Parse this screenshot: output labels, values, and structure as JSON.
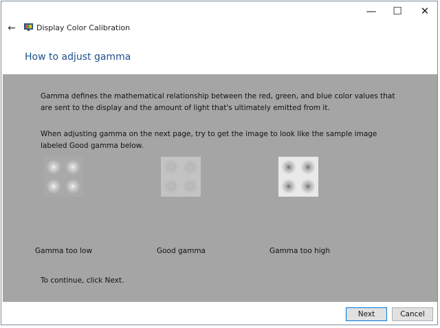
{
  "window": {
    "title": "Display Color Calibration",
    "controls": {
      "minimize": "—",
      "maximize": "☐",
      "close": "✕"
    },
    "back_icon": "←"
  },
  "header": {
    "page_title": "How to adjust gamma"
  },
  "main": {
    "paragraph1": "Gamma defines the mathematical relationship between the red, green, and blue color values that are sent to the display and the amount of light that's ultimately emitted from it.",
    "paragraph2": "When adjusting gamma on the next page, try to get the image to look like the sample image labeled Good gamma below.",
    "samples": [
      {
        "label": "Gamma too low",
        "tile": "#a9a9a9",
        "dot_center": "#e8e8e8",
        "dot_ring": "#9e9e9e"
      },
      {
        "label": "Good gamma",
        "tile": "#c3c3c3",
        "dot_center": "#b6b6b6",
        "dot_ring": "#b3b3b3"
      },
      {
        "label": "Gamma too high",
        "tile": "#e9e9e9",
        "dot_center": "#7a7a7a",
        "dot_ring": "#d0d0d0"
      }
    ],
    "continue_text": "To continue, click Next."
  },
  "footer": {
    "next_label": "Next",
    "cancel_label": "Cancel"
  },
  "colors": {
    "content_bg": "#a5a5a5",
    "title_blue": "#1e4f8c",
    "accent": "#0078d7"
  }
}
